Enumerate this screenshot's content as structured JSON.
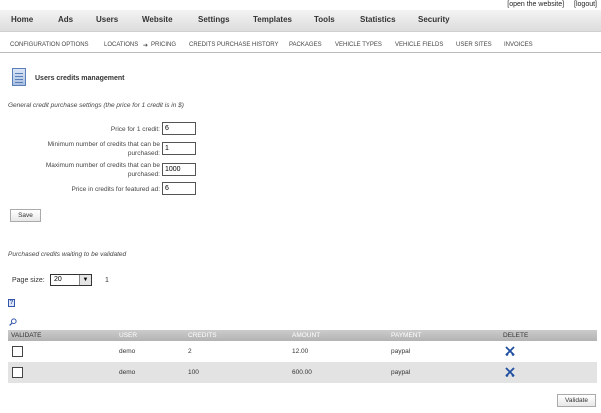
{
  "top_links": {
    "open_website": "[open the website]",
    "logout": "[logout]"
  },
  "main_nav": [
    "Home",
    "Ads",
    "Users",
    "Website",
    "Settings",
    "Templates",
    "Tools",
    "Statistics",
    "Security"
  ],
  "sub_nav": [
    "Configuration options",
    "Locations",
    "Pricing",
    "Credits purchase history",
    "Packages",
    "Vehicle types",
    "Vehicle fields",
    "User sites",
    "Invoices"
  ],
  "sub_nav_arrow": "➔",
  "page_title": "Users credits management",
  "settings": {
    "section_title": "General credit purchase settings (the price for 1 credit is in $)",
    "fields": [
      {
        "label": "Price for 1 credit:",
        "value": "6"
      },
      {
        "label": "Minimum number of credits that can be purchased:",
        "value": "1"
      },
      {
        "label": "Maximum number of credits that can be purchased:",
        "value": "1000"
      },
      {
        "label": "Price in credits for featured ad:",
        "value": "6"
      }
    ],
    "save_label": "Save"
  },
  "pending": {
    "section_title": "Purchased credits waiting to be validated",
    "page_size_label": "Page size:",
    "page_size_value": "20",
    "page_number": "1",
    "help_icon": "?",
    "columns": [
      "Validate",
      "User",
      "Credits",
      "Amount",
      "Payment",
      "Delete"
    ],
    "rows": [
      {
        "user": "demo",
        "credits": "2",
        "amount": "12.00",
        "payment": "paypal"
      },
      {
        "user": "demo",
        "credits": "100",
        "amount": "600.00",
        "payment": "paypal"
      }
    ],
    "validate_label": "Validate"
  },
  "colors": {
    "header_bg": "#b8b8b8",
    "alt_row": "#e3e3e3",
    "icon_blue": "#3355aa",
    "delete_icon": "#1f4fa0"
  }
}
